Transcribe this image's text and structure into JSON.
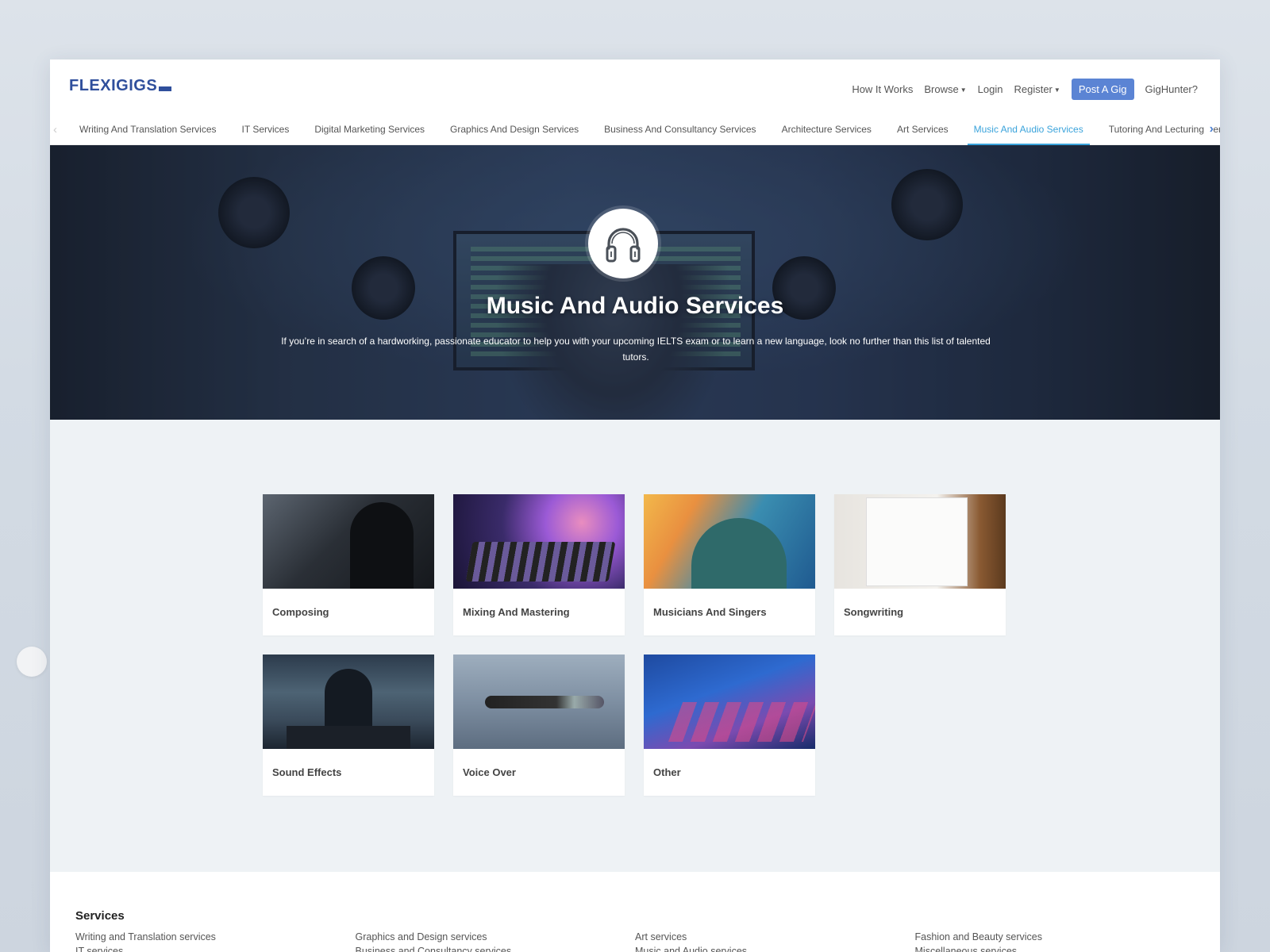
{
  "brand": {
    "logo": "FLEXIGIGS"
  },
  "topnav": {
    "how_it_works": "How It Works",
    "browse": "Browse",
    "login": "Login",
    "register": "Register",
    "post_gig": "Post A Gig",
    "gighunter": "GigHunter?"
  },
  "tabs": [
    {
      "label": "Writing And Translation Services"
    },
    {
      "label": "IT Services"
    },
    {
      "label": "Digital Marketing Services"
    },
    {
      "label": "Graphics And Design Services"
    },
    {
      "label": "Business And Consultancy Services"
    },
    {
      "label": "Architecture Services"
    },
    {
      "label": "Art Services"
    },
    {
      "label": "Music And Audio Services"
    },
    {
      "label": "Tutoring And Lecturing Ser"
    }
  ],
  "active_tab": "Music And Audio Services",
  "hero": {
    "icon": "headphones-icon",
    "title": "Music And Audio Services",
    "description": "If you’re in search of a hardworking, passionate educator to help you with your upcoming IELTS exam or to learn a new language, look no further than this list of talented tutors."
  },
  "categories": [
    {
      "label": "Composing"
    },
    {
      "label": "Mixing And Mastering"
    },
    {
      "label": "Musicians And Singers"
    },
    {
      "label": "Songwriting"
    },
    {
      "label": "Sound Effects"
    },
    {
      "label": "Voice Over"
    },
    {
      "label": "Other"
    }
  ],
  "footer": {
    "title": "Services",
    "columns": [
      [
        "Writing and Translation services",
        "IT services"
      ],
      [
        "Graphics and Design services",
        "Business and Consultancy services"
      ],
      [
        "Art services",
        "Music and Audio services"
      ],
      [
        "Fashion and Beauty services",
        "Miscellaneous services"
      ]
    ]
  },
  "colors": {
    "brand": "#2f4f9c",
    "accent": "#3aa3db",
    "button": "#5b84d4"
  }
}
